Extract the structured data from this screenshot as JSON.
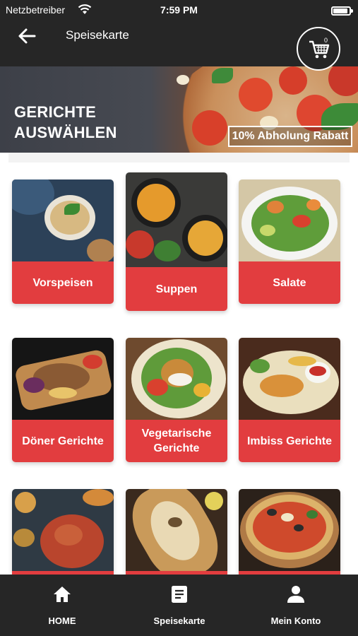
{
  "status_bar": {
    "carrier": "Netzbetreiber",
    "time": "7:59 PM",
    "battery_level": 0.9
  },
  "header": {
    "title": "Speisekarte",
    "cart_count": "0"
  },
  "banner": {
    "title_line1": "GERICHTE",
    "title_line2": "AUSWÄHLEN",
    "badge": "10% Abholung Rabatt"
  },
  "categories": [
    {
      "label": "Vorspeisen"
    },
    {
      "label": "Suppen"
    },
    {
      "label": "Salate"
    },
    {
      "label": "Döner Gerichte"
    },
    {
      "label": "Vegetarische Gerichte"
    },
    {
      "label": "Imbiss Gerichte"
    },
    {
      "label": ""
    },
    {
      "label": ""
    },
    {
      "label": ""
    }
  ],
  "bottom_nav": [
    {
      "label": "HOME",
      "icon": "home-icon"
    },
    {
      "label": "Speisekarte",
      "icon": "menu-list-icon"
    },
    {
      "label": "Mein Konto",
      "icon": "user-icon"
    }
  ],
  "colors": {
    "accent": "#e23d3f",
    "bar": "#262626"
  }
}
